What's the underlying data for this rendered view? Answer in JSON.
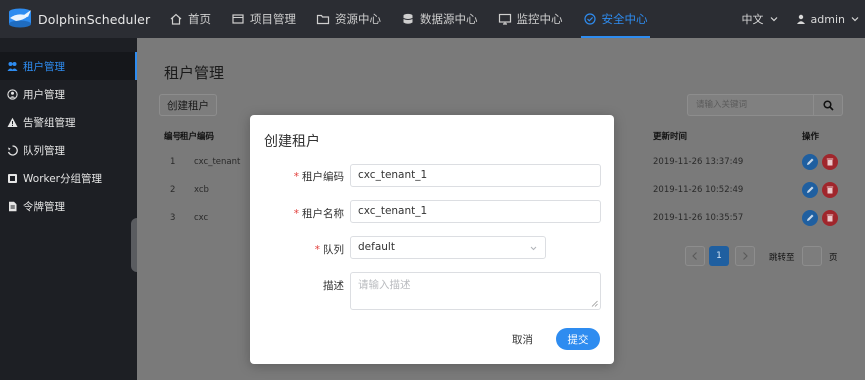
{
  "app": {
    "brand": "DolphinScheduler"
  },
  "nav": {
    "items": [
      {
        "label": "首页",
        "icon": "home-icon"
      },
      {
        "label": "项目管理",
        "icon": "project-icon"
      },
      {
        "label": "资源中心",
        "icon": "folder-icon"
      },
      {
        "label": "数据源中心",
        "icon": "database-icon"
      },
      {
        "label": "监控中心",
        "icon": "monitor-icon"
      },
      {
        "label": "安全中心",
        "icon": "shield-icon",
        "active": true
      }
    ],
    "language": "中文",
    "user": "admin"
  },
  "sidebar": {
    "items": [
      {
        "label": "租户管理",
        "icon": "tenant-icon",
        "active": true
      },
      {
        "label": "用户管理",
        "icon": "user-icon"
      },
      {
        "label": "告警组管理",
        "icon": "warning-icon"
      },
      {
        "label": "队列管理",
        "icon": "queue-icon"
      },
      {
        "label": "Worker分组管理",
        "icon": "worker-group-icon"
      },
      {
        "label": "令牌管理",
        "icon": "token-icon"
      }
    ]
  },
  "page": {
    "title": "租户管理",
    "create_button": "创建租户",
    "search_placeholder": "请输入关键词"
  },
  "table": {
    "headers": {
      "no": "编号",
      "code": "租户编码",
      "updated": "更新时间",
      "actions": "操作"
    },
    "rows": [
      {
        "no": "1",
        "code": "cxc_tenant",
        "updated": "2019-11-26 13:37:49"
      },
      {
        "no": "2",
        "code": "xcb",
        "updated": "2019-11-26 10:52:49"
      },
      {
        "no": "3",
        "code": "cxc",
        "updated": "2019-11-26 10:35:57"
      }
    ]
  },
  "pagination": {
    "current": "1",
    "jump_label": "跳转至",
    "page_suffix": "页"
  },
  "modal": {
    "title": "创建租户",
    "tenant_code_label": "租户编码",
    "tenant_code_value": "cxc_tenant_1",
    "tenant_name_label": "租户名称",
    "tenant_name_value": "cxc_tenant_1",
    "queue_label": "队列",
    "queue_value": "default",
    "desc_label": "描述",
    "desc_placeholder": "请输入描述",
    "cancel": "取消",
    "submit": "提交"
  },
  "colors": {
    "accent": "#2e8cf0",
    "required": "#e23c39",
    "topbar": "#2b2d33",
    "sidebar": "#1d1f24"
  }
}
